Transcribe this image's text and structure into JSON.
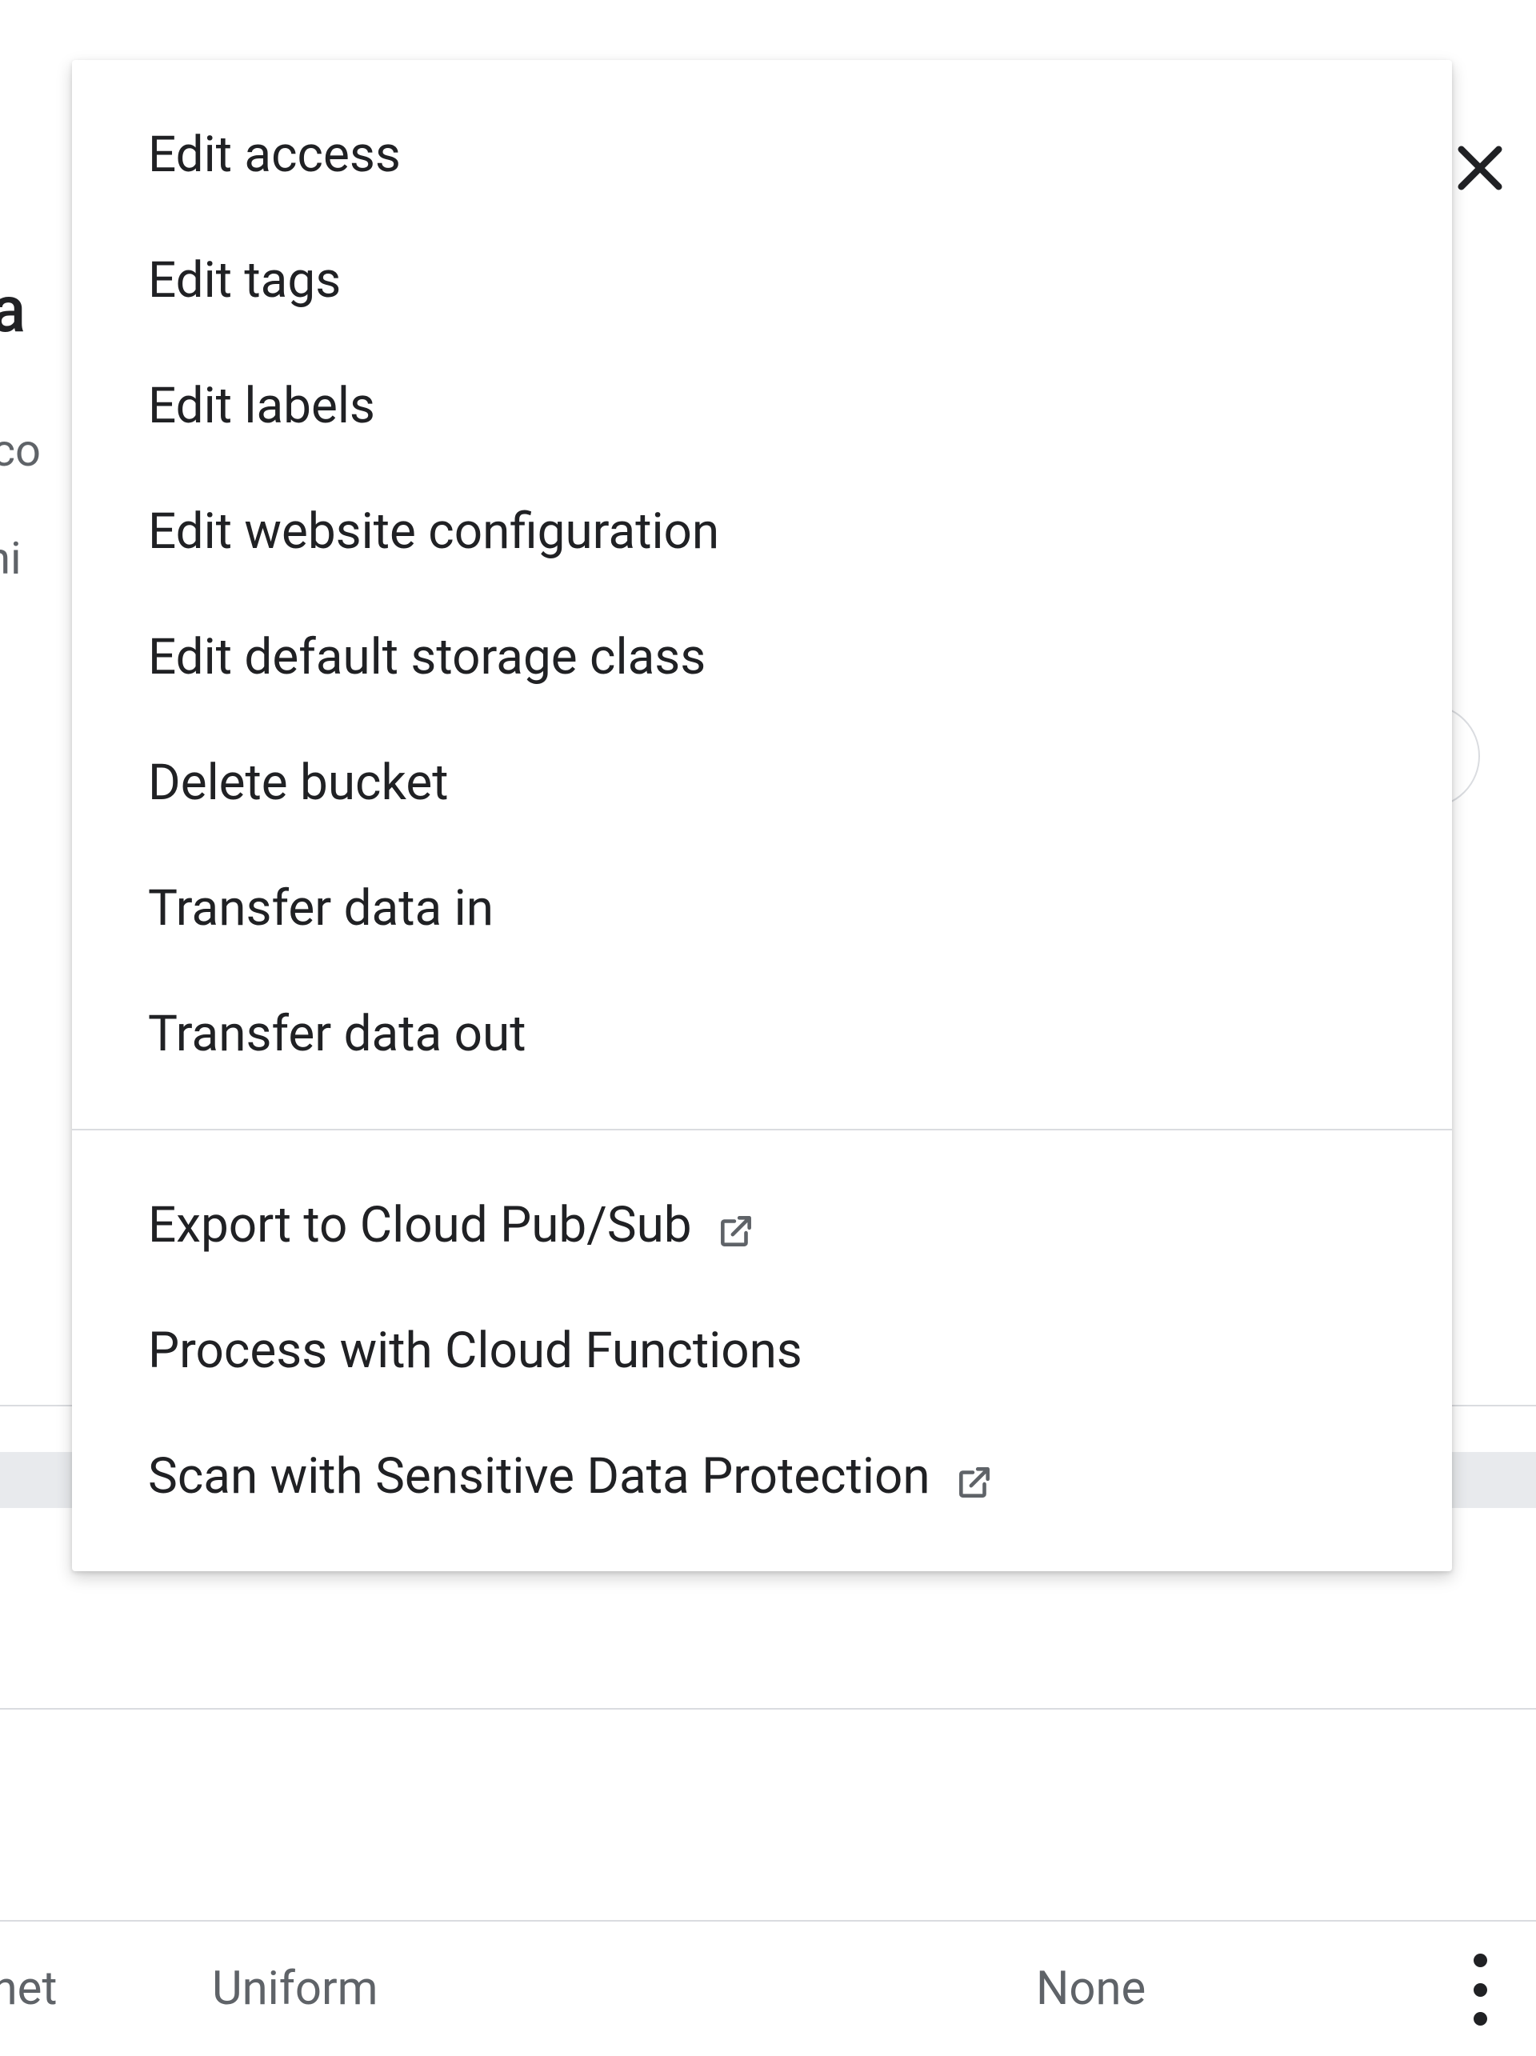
{
  "background": {
    "title_fragment": "da",
    "line1_fragment": "eco",
    "line2_fragment": "vhi"
  },
  "menu": {
    "group1": [
      {
        "label": "Edit access"
      },
      {
        "label": "Edit tags"
      },
      {
        "label": "Edit labels"
      },
      {
        "label": "Edit website configuration"
      },
      {
        "label": "Edit default storage class"
      },
      {
        "label": "Delete bucket"
      },
      {
        "label": "Transfer data in"
      },
      {
        "label": "Transfer data out"
      }
    ],
    "group2": [
      {
        "label": "Export to Cloud Pub/Sub",
        "external": true
      },
      {
        "label": "Process with Cloud Functions",
        "external": false
      },
      {
        "label": "Scan with Sensitive Data Protection",
        "external": true
      }
    ]
  },
  "footer": {
    "col1": "rnet",
    "col2": "Uniform",
    "col3": "None"
  }
}
